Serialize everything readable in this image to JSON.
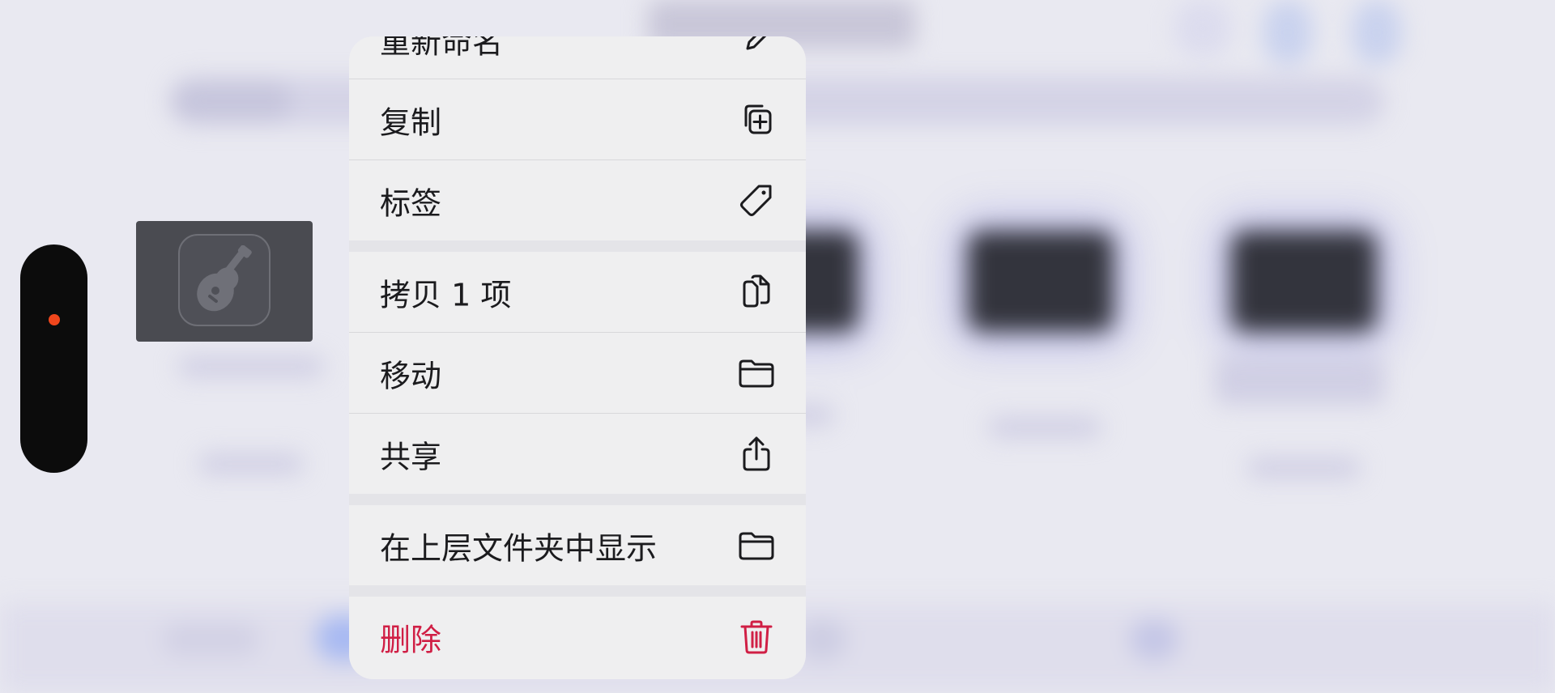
{
  "context_menu": {
    "items": [
      {
        "label": "重新命名",
        "icon": "pencil-icon"
      },
      {
        "label": "复制",
        "icon": "duplicate-plus-icon"
      },
      {
        "label": "标签",
        "icon": "tag-icon"
      },
      {
        "label": "拷贝 1 项",
        "icon": "copy-docs-icon"
      },
      {
        "label": "移动",
        "icon": "folder-icon"
      },
      {
        "label": "共享",
        "icon": "share-icon"
      },
      {
        "label": "在上层文件夹中显示",
        "icon": "folder-icon"
      },
      {
        "label": "删除",
        "icon": "trash-icon",
        "destructive": true
      }
    ]
  },
  "recording_indicator": {
    "color": "#f0461c"
  },
  "selected_file": {
    "icon": "garageband-guitar-icon"
  },
  "colors": {
    "menu_background": "#efeff0",
    "text": "#1b1b1e",
    "destructive": "#d01f45"
  }
}
